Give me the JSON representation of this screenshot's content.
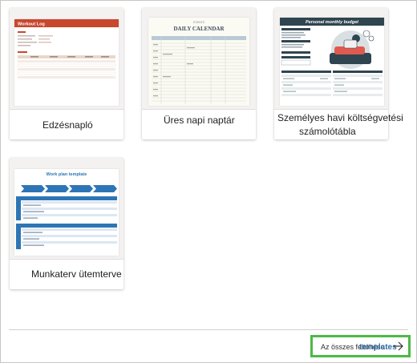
{
  "templates": [
    {
      "name": "Edzésnapló",
      "thumb_title": "Workout Log",
      "accent": "#c8472e"
    },
    {
      "name": "Üres napi naptár",
      "thumb_subtitle": "EVENTS",
      "thumb_title": "DAILY CALENDAR",
      "accent": "#3c6b8a"
    },
    {
      "name_line1": "Személyes havi költségvetési",
      "name_line2": "számolótábla",
      "thumb_title": "Personal monthly budget",
      "accent": "#2f4550"
    },
    {
      "name": "Munkaterv ütemterve",
      "thumb_title": "Work plan template",
      "accent": "#2e75b6"
    }
  ],
  "more_button": {
    "label_part1": "Az összes feltöltése",
    "label_part2": "templates",
    "icon": "arrow-right-icon"
  },
  "colors": {
    "highlight": "#4cb947",
    "link": "#2e6ea6"
  }
}
